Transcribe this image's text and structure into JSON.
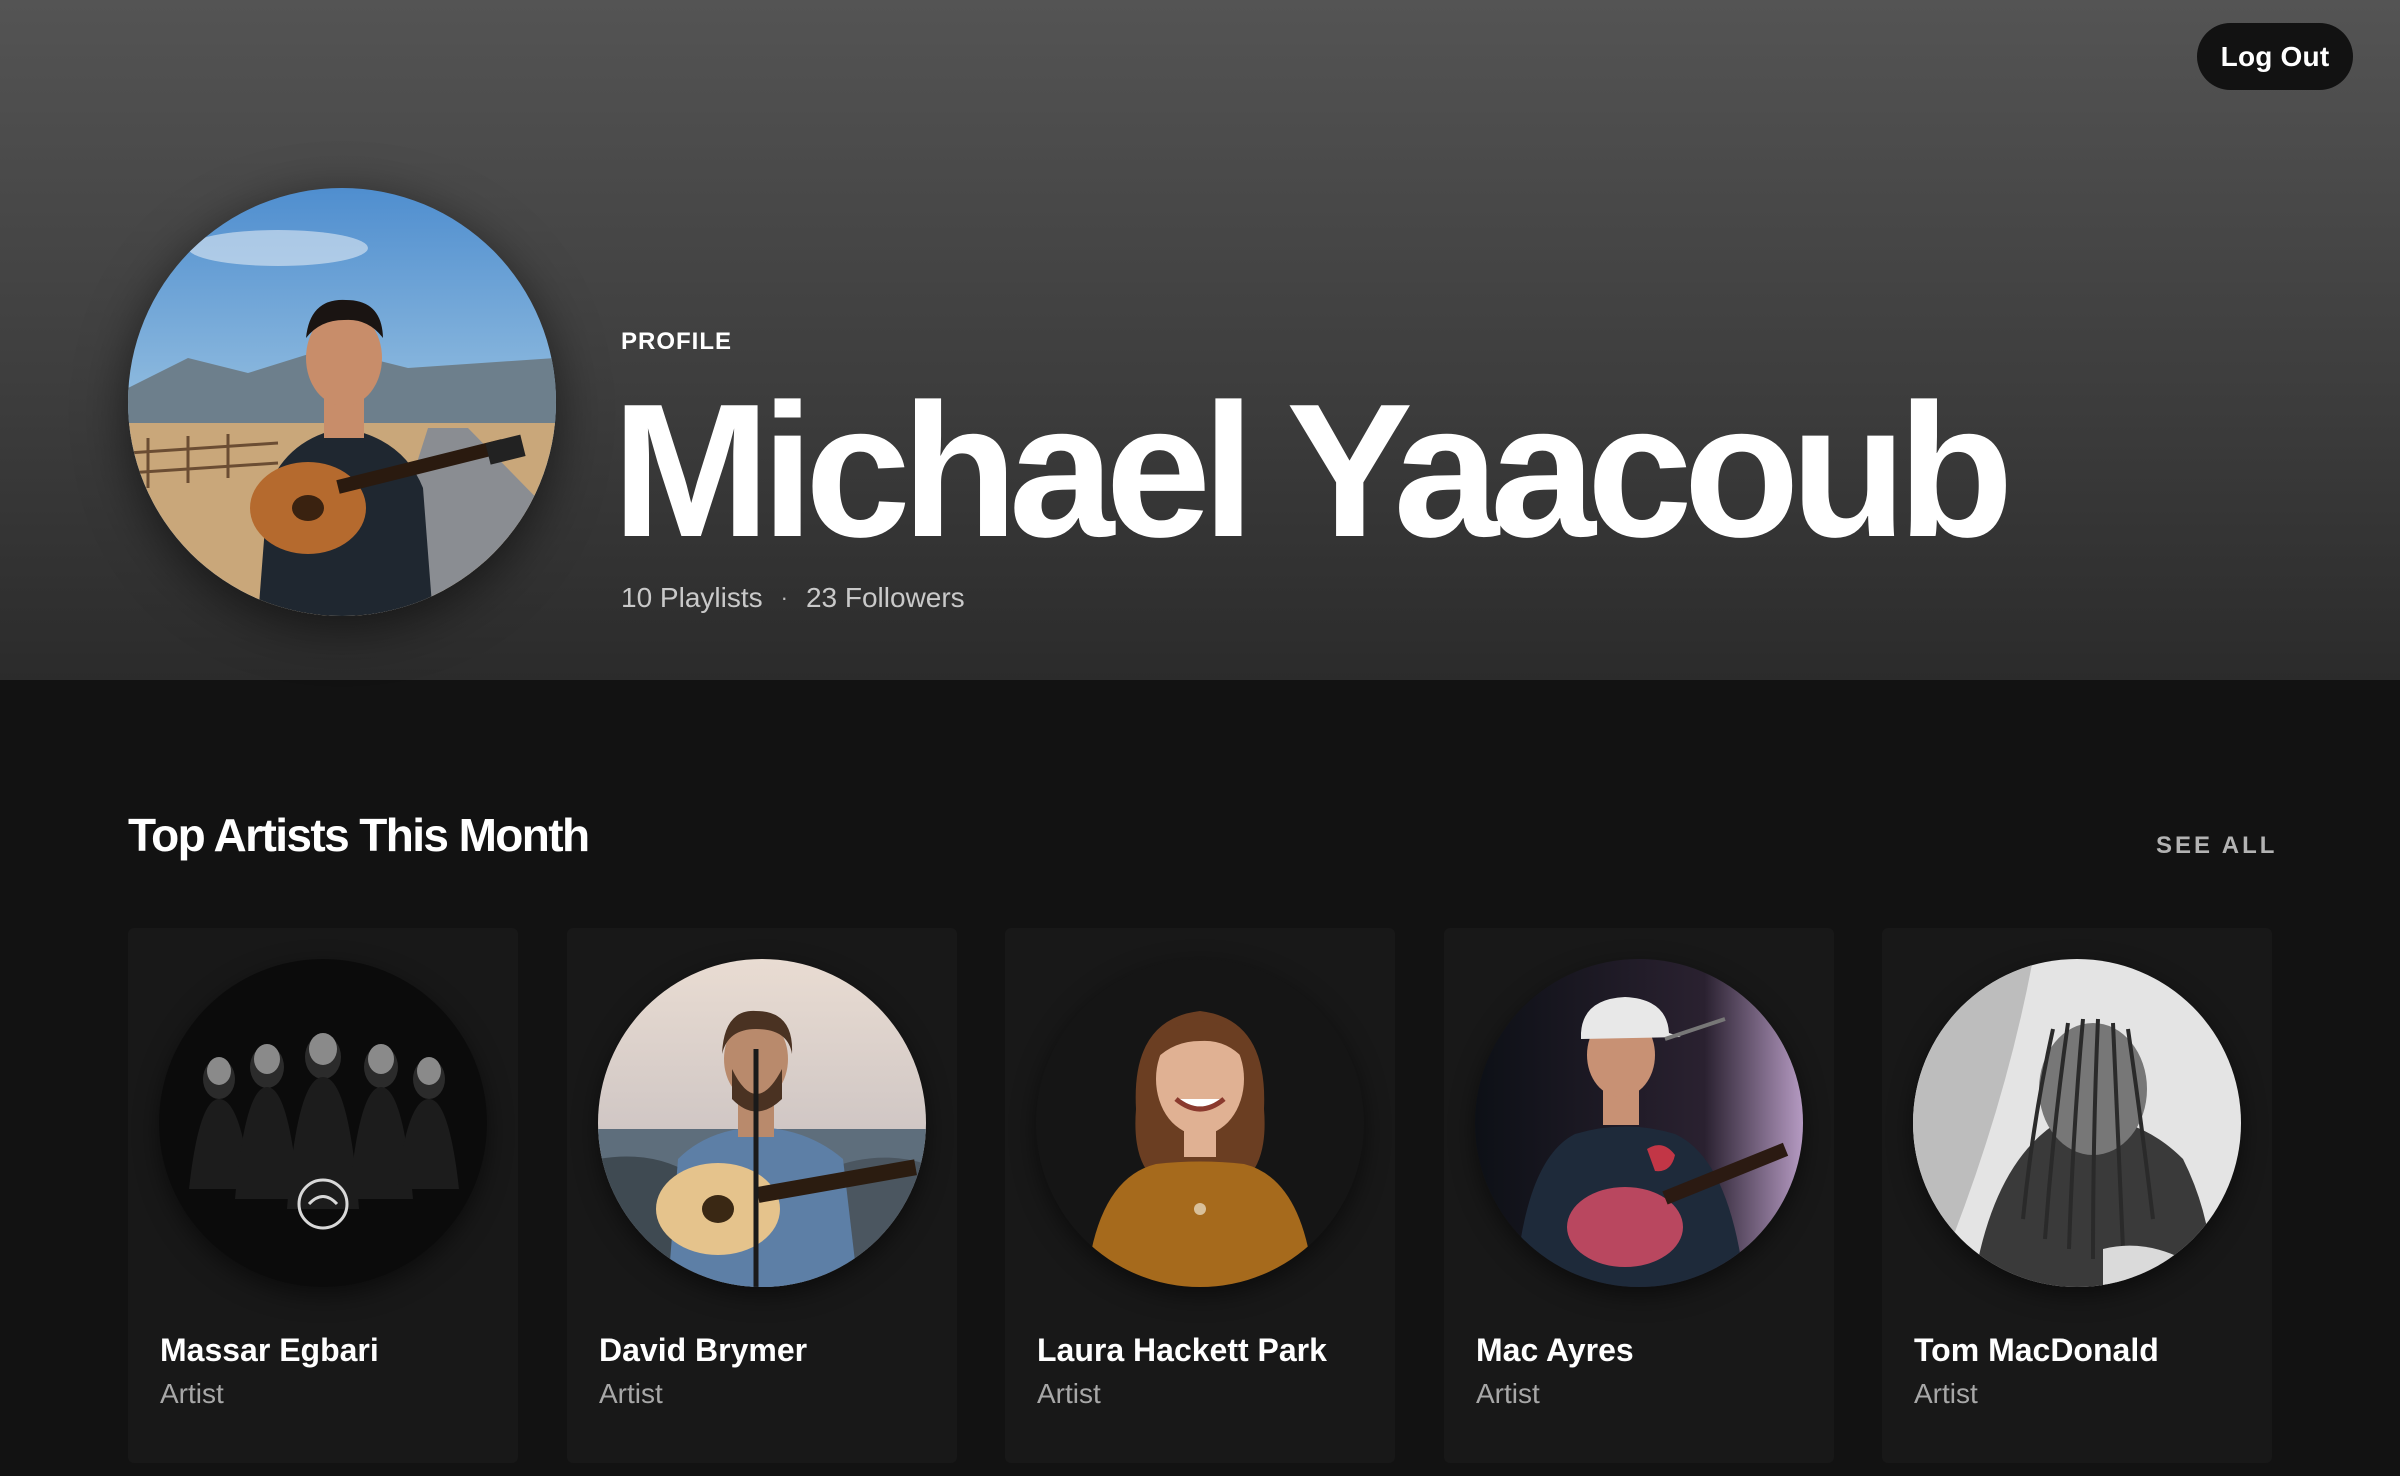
{
  "header": {
    "logout_label": "Log Out"
  },
  "profile": {
    "label": "PROFILE",
    "name": "Michael Yaacoub",
    "playlists": "10 Playlists",
    "separator": "·",
    "followers": "23 Followers"
  },
  "section": {
    "title": "Top Artists This Month",
    "see_all": "SEE ALL"
  },
  "artists": [
    {
      "name": "Massar Egbari",
      "type": "Artist"
    },
    {
      "name": "David Brymer",
      "type": "Artist"
    },
    {
      "name": "Laura Hackett Park",
      "type": "Artist"
    },
    {
      "name": "Mac Ayres",
      "type": "Artist"
    },
    {
      "name": "Tom MacDonald",
      "type": "Artist"
    }
  ],
  "colors": {
    "background": "#121212",
    "card": "#181818",
    "secondary_text": "#a7a7a7"
  }
}
